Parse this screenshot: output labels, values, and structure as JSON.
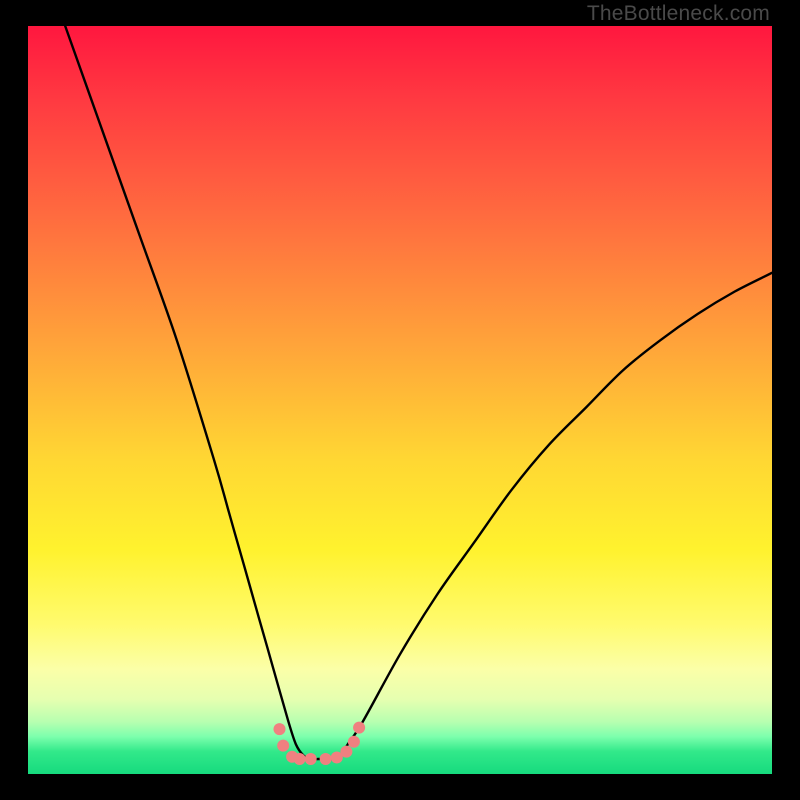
{
  "watermark": "TheBottleneck.com",
  "chart_data": {
    "type": "line",
    "title": "",
    "xlabel": "",
    "ylabel": "",
    "xlim": [
      0,
      100
    ],
    "ylim": [
      0,
      100
    ],
    "background_gradient_stops": [
      {
        "pos": 0,
        "color": "#ff173f"
      },
      {
        "pos": 25,
        "color": "#ff6a3f"
      },
      {
        "pos": 58,
        "color": "#ffd733"
      },
      {
        "pos": 80,
        "color": "#fffb6e"
      },
      {
        "pos": 95,
        "color": "#7dffad"
      },
      {
        "pos": 100,
        "color": "#16da7e"
      }
    ],
    "series": [
      {
        "name": "bottleneck-curve",
        "color": "#000000",
        "x": [
          5,
          10,
          15,
          20,
          25,
          27,
          29,
          31,
          33,
          35,
          36,
          37,
          38,
          39,
          40,
          41,
          42,
          43,
          45,
          50,
          55,
          60,
          65,
          70,
          75,
          80,
          85,
          90,
          95,
          100
        ],
        "y": [
          100,
          86,
          72,
          58,
          42,
          35,
          28,
          21,
          14,
          7,
          4,
          2.5,
          2,
          2,
          2,
          2,
          2.5,
          4,
          7,
          16,
          24,
          31,
          38,
          44,
          49,
          54,
          58,
          61.5,
          64.5,
          67
        ]
      },
      {
        "name": "valley-marker",
        "color": "#f08080",
        "style": "dots",
        "x": [
          33.8,
          34.3,
          35.5,
          36.5,
          38.0,
          40.0,
          41.5,
          42.8,
          43.8,
          44.5
        ],
        "y": [
          6.0,
          3.8,
          2.3,
          2.0,
          2.0,
          2.0,
          2.2,
          3.0,
          4.3,
          6.2
        ]
      }
    ]
  }
}
